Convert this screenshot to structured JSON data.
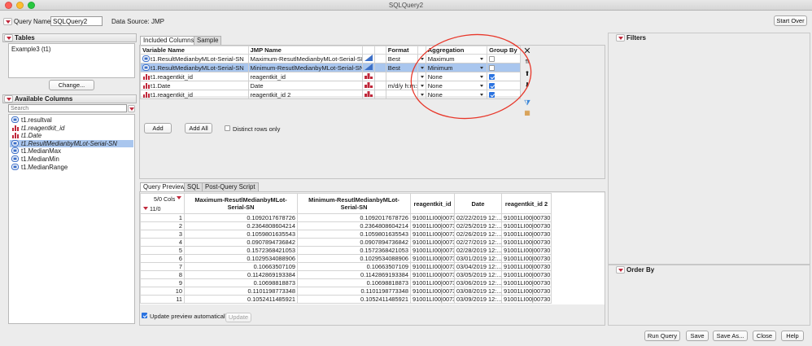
{
  "window": {
    "title": "SQLQuery2"
  },
  "query": {
    "name_label": "Query Name:",
    "name_value": "SQLQuery2",
    "source_label": "Data Source:",
    "source_value": "JMP",
    "start_over": "Start Over"
  },
  "tables": {
    "header": "Tables",
    "items": [
      "Example3 (t1)"
    ],
    "change_button": "Change..."
  },
  "available_columns": {
    "header": "Available Columns",
    "search_placeholder": "Search",
    "items": [
      {
        "label": "t1.resultval",
        "icon": "continuous-column-icon",
        "italic": false,
        "selected": false
      },
      {
        "label": "t1.reagentkit_id",
        "icon": "nominal-column-icon",
        "italic": true,
        "selected": false
      },
      {
        "label": "t1.Date",
        "icon": "nominal-column-icon",
        "italic": true,
        "selected": false
      },
      {
        "label": "t1.ResultMedianbyMLot-Serial-SN",
        "icon": "continuous-column-icon",
        "italic": true,
        "selected": true
      },
      {
        "label": "t1.MedianMax",
        "icon": "continuous-column-icon",
        "italic": false,
        "selected": false
      },
      {
        "label": "t1.MedianMin",
        "icon": "continuous-column-icon",
        "italic": false,
        "selected": false
      },
      {
        "label": "t1.MedianRange",
        "icon": "continuous-column-icon",
        "italic": false,
        "selected": false
      }
    ]
  },
  "included": {
    "tabs": [
      "Included Columns",
      "Sample"
    ],
    "headers": [
      "Variable Name",
      "JMP Name",
      "Format",
      "Aggregation",
      "Group By"
    ],
    "rows": [
      {
        "var": "t1.ResultMedianbyMLot-Serial-SN",
        "jmp": "Maximum-ResutlMedianbyMLot-Serial-SN",
        "format": "Best",
        "agg": "Maximum",
        "group": false,
        "selected": false,
        "icon": "continuous-column-icon"
      },
      {
        "var": "t1.ResultMedianbyMLot-Serial-SN",
        "jmp": "Minimum-ResutlMedianbyMLot-Serial-SN",
        "format": "Best",
        "agg": "Minimum",
        "group": false,
        "selected": true,
        "icon": "continuous-column-icon"
      },
      {
        "var": "t1.reagentkit_id",
        "jmp": "reagentkit_id",
        "format": "",
        "agg": "None",
        "group": true,
        "selected": false,
        "icon": "nominal-column-icon"
      },
      {
        "var": "t1.Date",
        "jmp": "Date",
        "format": "m/d/y h:m:s",
        "agg": "None",
        "group": true,
        "selected": false,
        "icon": "nominal-column-icon"
      },
      {
        "var": "t1.reagentkit_id",
        "jmp": "reagentkit_id 2",
        "format": "",
        "agg": "None",
        "group": true,
        "selected": false,
        "icon": "nominal-column-icon"
      }
    ],
    "add_button": "Add",
    "add_all_button": "Add All",
    "distinct_label": "Distinct rows only"
  },
  "preview": {
    "tabs": [
      "Query Preview",
      "SQL",
      "Post-Query Script"
    ],
    "cols_label": "5/0 Cols",
    "rows_label": "11/0",
    "headers": [
      "Maximum-ResutlMedianbyMLot-Serial-SN",
      "Minimum-ResutlMedianbyMLot-Serial-SN",
      "reagentkit_id",
      "Date",
      "reagentkit_id 2"
    ],
    "rows": [
      [
        "1",
        "0.1092017678726",
        "0.1092017678726",
        "91001LI00|00730",
        "02/22/2019 12:...",
        "91001LI00|00730"
      ],
      [
        "2",
        "0.2364808604214",
        "0.2364808604214",
        "91001LI00|00730",
        "02/25/2019 12:...",
        "91001LI00|00730"
      ],
      [
        "3",
        "0.1059801635543",
        "0.1059801635543",
        "91001LI00|00730",
        "02/26/2019 12:...",
        "91001LI00|00730"
      ],
      [
        "4",
        "0.0907894736842",
        "0.0907894736842",
        "91001LI00|00730",
        "02/27/2019 12:...",
        "91001LI00|00730"
      ],
      [
        "5",
        "0.1572368421053",
        "0.1572368421053",
        "91001LI00|00730",
        "02/28/2019 12:...",
        "91001LI00|00730"
      ],
      [
        "6",
        "0.1029534088906",
        "0.1029534088906",
        "91001LI00|00730",
        "03/01/2019 12:...",
        "91001LI00|00730"
      ],
      [
        "7",
        "0.10663507109",
        "0.10663507109",
        "91001LI00|00730",
        "03/04/2019 12:...",
        "91001LI00|00730"
      ],
      [
        "8",
        "0.1142869193384",
        "0.1142869193384",
        "91001LI00|00730",
        "03/05/2019 12:...",
        "91001LI00|00730"
      ],
      [
        "9",
        "0.10698818873",
        "0.10698818873",
        "91001LI00|00730",
        "03/06/2019 12:...",
        "91001LI00|00730"
      ],
      [
        "10",
        "0.1101198773348",
        "0.1101198773348",
        "91001LI00|00730",
        "03/08/2019 12:...",
        "91001LI00|00730"
      ],
      [
        "11",
        "0.1052411485921",
        "0.1052411485921",
        "91001LI00|00730",
        "03/09/2019 12:...",
        "91001LI00|00730"
      ]
    ],
    "auto_update_label": "Update preview automatically",
    "update_button": "Update"
  },
  "filters": {
    "header": "Filters"
  },
  "order_by": {
    "header": "Order By"
  },
  "footer": {
    "buttons": [
      "Run Query",
      "Save",
      "Save As...",
      "Close",
      "Help"
    ]
  },
  "colors": {
    "accent": "#2b73e0",
    "selection": "#a9c6ee",
    "annotation": "#e8382b"
  }
}
